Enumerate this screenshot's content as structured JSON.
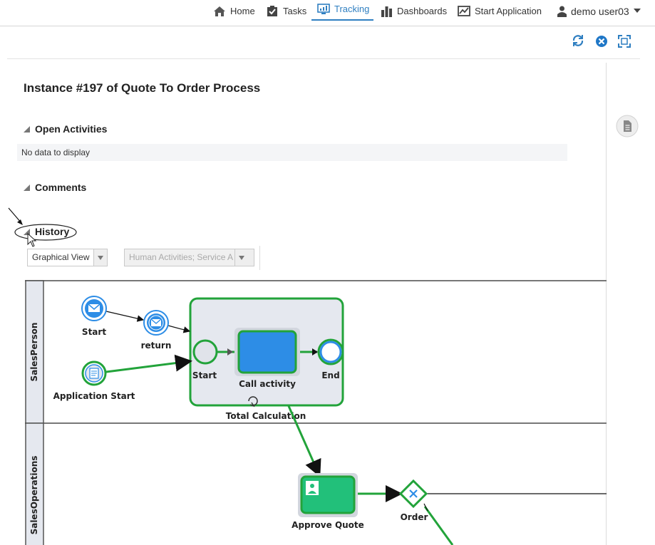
{
  "nav": {
    "items": [
      {
        "label": "Home",
        "icon": "home-icon"
      },
      {
        "label": "Tasks",
        "icon": "tasks-icon"
      },
      {
        "label": "Tracking",
        "icon": "tracking-icon",
        "active": true
      },
      {
        "label": "Dashboards",
        "icon": "dashboards-icon"
      },
      {
        "label": "Start Application",
        "icon": "start-application-icon"
      }
    ],
    "user": "demo user03"
  },
  "toolbar": {
    "icons": [
      "refresh-icon",
      "close-icon",
      "maximize-icon"
    ]
  },
  "page": {
    "title": "Instance #197 of Quote To Order Process",
    "open_activities": "Open Activities",
    "no_data": "No data to display",
    "comments": "Comments",
    "history": "History"
  },
  "history_controls": {
    "view_select": "Graphical View",
    "filter_select": "Human Activities; Service A"
  },
  "colors": {
    "accent": "#2f7fc1",
    "active_path": "#22a33a",
    "task_blue": "#2d8de6",
    "task_green": "#22c07a"
  },
  "diagram": {
    "lanes": [
      "SalesPerson",
      "SalesOperations"
    ],
    "nodes": {
      "start": "Start",
      "return": "return",
      "application_start": "Application Start",
      "sub_start": "Start",
      "call_activity": "Call activity",
      "sub_end": "End",
      "total_calculation": "Total Calculation",
      "approve_quote": "Approve Quote",
      "order": "Order"
    }
  }
}
